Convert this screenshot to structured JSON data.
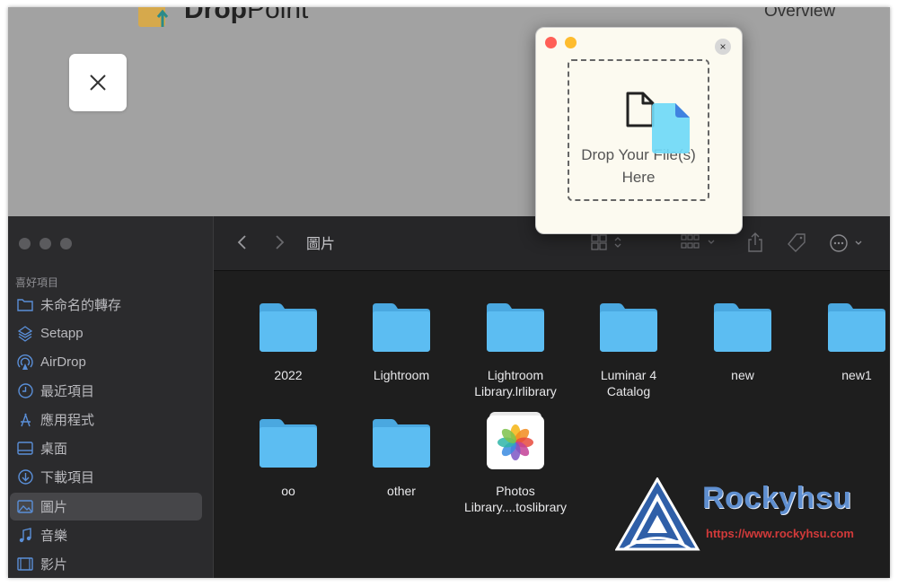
{
  "webpage": {
    "app_name_bold": "Drop",
    "app_name_rest": "Point",
    "nav_overview": "Overview"
  },
  "finder": {
    "sidebar": {
      "section_title": "喜好項目",
      "items": [
        {
          "label": "未命名的轉存",
          "icon": "folder-icon"
        },
        {
          "label": "Setapp",
          "icon": "setapp-icon"
        },
        {
          "label": "AirDrop",
          "icon": "airdrop-icon"
        },
        {
          "label": "最近項目",
          "icon": "clock-icon"
        },
        {
          "label": "應用程式",
          "icon": "applications-icon"
        },
        {
          "label": "桌面",
          "icon": "desktop-icon"
        },
        {
          "label": "下載項目",
          "icon": "download-icon"
        },
        {
          "label": "圖片",
          "icon": "photo-icon",
          "selected": true
        },
        {
          "label": "音樂",
          "icon": "music-icon"
        },
        {
          "label": "影片",
          "icon": "film-icon"
        }
      ]
    },
    "toolbar": {
      "title": "圖片"
    },
    "items": [
      {
        "name": "2022",
        "type": "folder"
      },
      {
        "name": "Lightroom",
        "type": "folder"
      },
      {
        "name": "Lightroom Library.lrlibrary",
        "line1": "Lightroom",
        "line2": "Library.lrlibrary",
        "type": "folder"
      },
      {
        "name": "Luminar 4 Catalog",
        "line1": "Luminar 4",
        "line2": "Catalog",
        "type": "folder"
      },
      {
        "name": "new",
        "type": "folder"
      },
      {
        "name": "new1",
        "type": "folder"
      },
      {
        "name": "oo",
        "type": "folder"
      },
      {
        "name": "other",
        "type": "folder"
      },
      {
        "name": "Photos Library....toslibrary",
        "line1": "Photos",
        "line2": "Library....toslibrary",
        "type": "photos-library"
      }
    ]
  },
  "popup": {
    "drop_line1": "Drop Your File(s)",
    "drop_line2": "Here",
    "close_glyph": "×"
  },
  "watermark": {
    "brand": "Rockyhsu",
    "url": "https://www.rockyhsu.com"
  },
  "colors": {
    "folder_blue": "#57b8f0",
    "sidebar_bg": "#2b2b2d",
    "content_bg": "#1e1e1e",
    "popup_bg": "#fcfaf0",
    "close_red": "#ff5f57",
    "minimize_yellow": "#febc2e"
  }
}
